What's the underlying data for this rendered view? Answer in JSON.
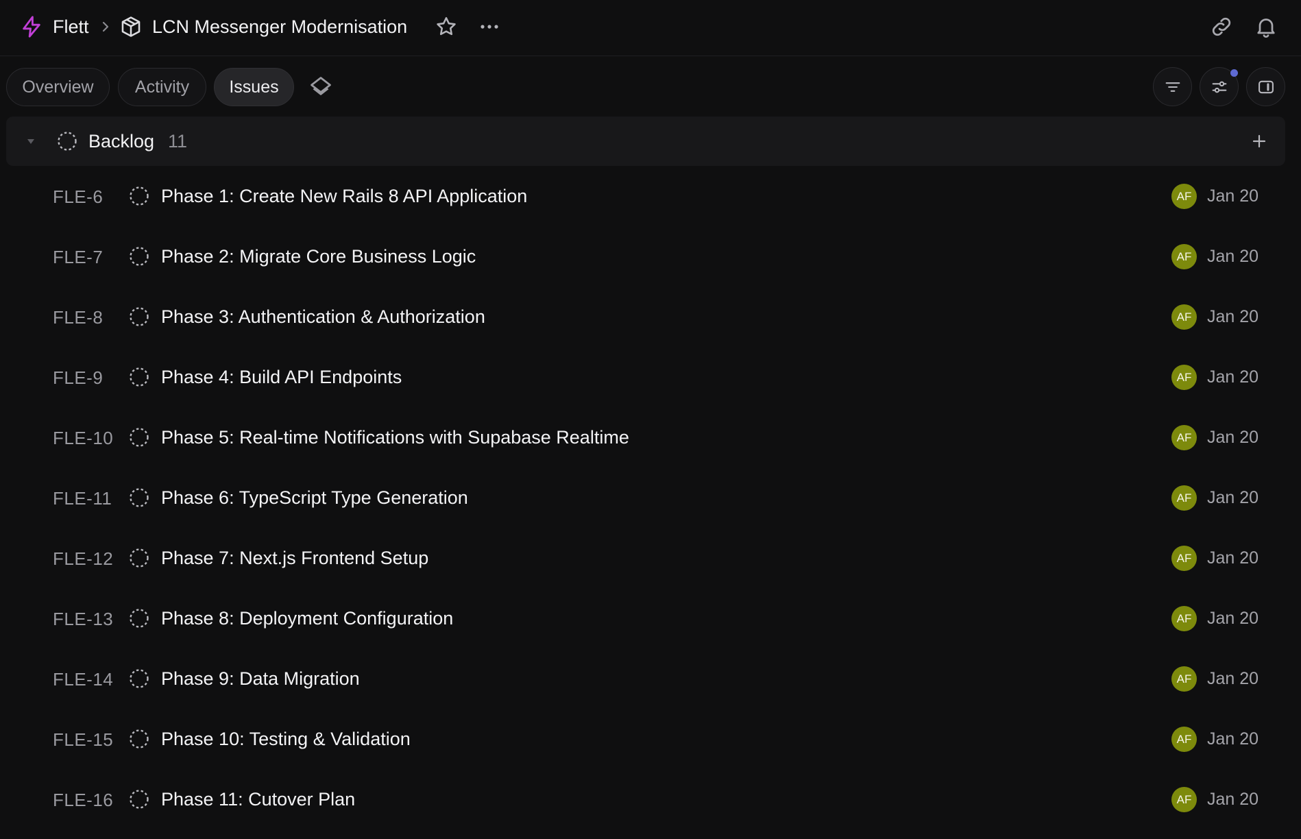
{
  "colors": {
    "background": "#0f0f10",
    "workspace_accent": "#c13fd6",
    "avatar_bg": "#7d8a0c",
    "notification_dot": "#5e6ad2"
  },
  "header": {
    "workspace_name": "Flett",
    "workspace_icon": "lightning-icon",
    "project_icon": "cube-icon",
    "project_name": "LCN Messenger Modernisation"
  },
  "tabs": [
    {
      "label": "Overview",
      "active": false
    },
    {
      "label": "Activity",
      "active": false
    },
    {
      "label": "Issues",
      "active": true
    }
  ],
  "toolbar_icons": [
    "filter-icon",
    "display-options-icon",
    "side-panel-icon"
  ],
  "group": {
    "title": "Backlog",
    "count": "11"
  },
  "issues": [
    {
      "id": "FLE-6",
      "title": "Phase 1: Create New Rails 8 API Application",
      "assignee": "AF",
      "date": "Jan 20"
    },
    {
      "id": "FLE-7",
      "title": "Phase 2: Migrate Core Business Logic",
      "assignee": "AF",
      "date": "Jan 20"
    },
    {
      "id": "FLE-8",
      "title": "Phase 3: Authentication & Authorization",
      "assignee": "AF",
      "date": "Jan 20"
    },
    {
      "id": "FLE-9",
      "title": "Phase 4: Build API Endpoints",
      "assignee": "AF",
      "date": "Jan 20"
    },
    {
      "id": "FLE-10",
      "title": "Phase 5: Real-time Notifications with Supabase Realtime",
      "assignee": "AF",
      "date": "Jan 20"
    },
    {
      "id": "FLE-11",
      "title": "Phase 6: TypeScript Type Generation",
      "assignee": "AF",
      "date": "Jan 20"
    },
    {
      "id": "FLE-12",
      "title": "Phase 7: Next.js Frontend Setup",
      "assignee": "AF",
      "date": "Jan 20"
    },
    {
      "id": "FLE-13",
      "title": "Phase 8: Deployment Configuration",
      "assignee": "AF",
      "date": "Jan 20"
    },
    {
      "id": "FLE-14",
      "title": "Phase 9: Data Migration",
      "assignee": "AF",
      "date": "Jan 20"
    },
    {
      "id": "FLE-15",
      "title": "Phase 10: Testing & Validation",
      "assignee": "AF",
      "date": "Jan 20"
    },
    {
      "id": "FLE-16",
      "title": "Phase 11: Cutover Plan",
      "assignee": "AF",
      "date": "Jan 20"
    }
  ]
}
